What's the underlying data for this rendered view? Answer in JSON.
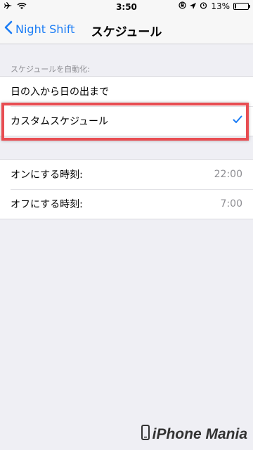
{
  "status_bar": {
    "time": "3:50",
    "battery_text": "13%",
    "battery_level": 0.13
  },
  "nav": {
    "back_label": "Night Shift",
    "title": "スケジュール"
  },
  "schedule_section": {
    "header": "スケジュールを自動化:",
    "options": [
      {
        "label": "日の入から日の出まで",
        "selected": false
      },
      {
        "label": "カスタムスケジュール",
        "selected": true
      }
    ]
  },
  "times": {
    "rows": [
      {
        "label": "オンにする時刻:",
        "value": "22:00"
      },
      {
        "label": "オフにする時刻:",
        "value": "7:00"
      }
    ]
  },
  "watermark": {
    "text": "iPhone Mania"
  },
  "colors": {
    "accent": "#1a7cf5",
    "highlight": "#e84d52",
    "background": "#efeff4"
  },
  "icons": [
    "airplane-icon",
    "wifi-icon",
    "rotation-lock-icon",
    "location-icon",
    "alarm-icon",
    "battery-icon",
    "chevron-left-icon",
    "checkmark-icon",
    "phone-icon"
  ]
}
